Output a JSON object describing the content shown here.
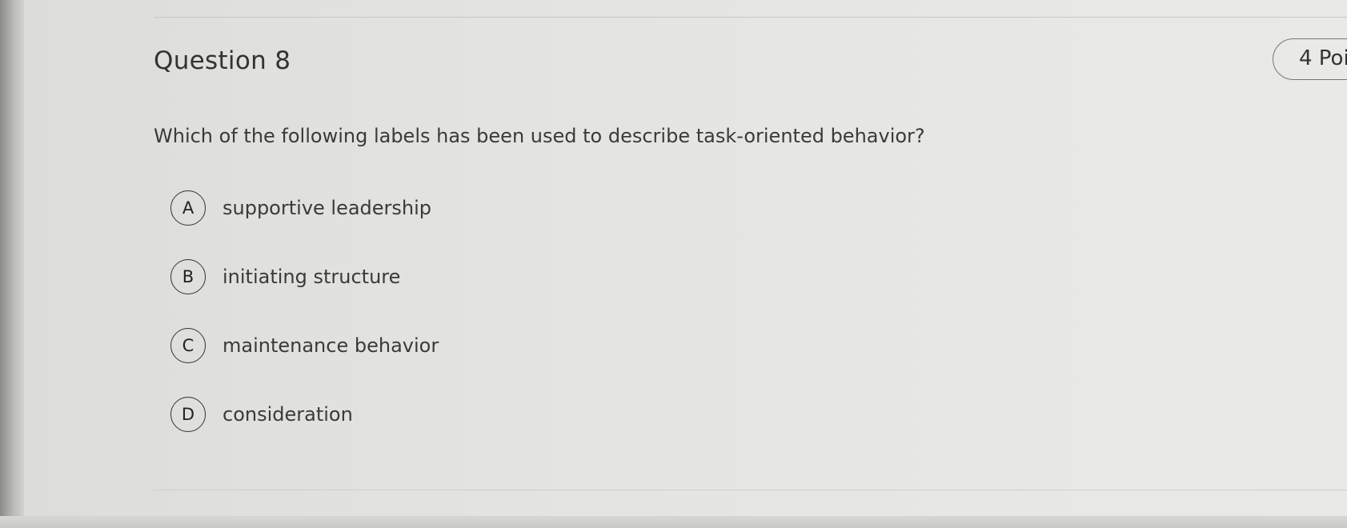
{
  "question": {
    "title": "Question 8",
    "points": "4 Poi",
    "prompt": "Which of the following labels has been used to describe task-oriented behavior?"
  },
  "options": [
    {
      "letter": "A",
      "label": "supportive leadership"
    },
    {
      "letter": "B",
      "label": "initiating structure"
    },
    {
      "letter": "C",
      "label": "maintenance behavior"
    },
    {
      "letter": "D",
      "label": "consideration"
    }
  ]
}
